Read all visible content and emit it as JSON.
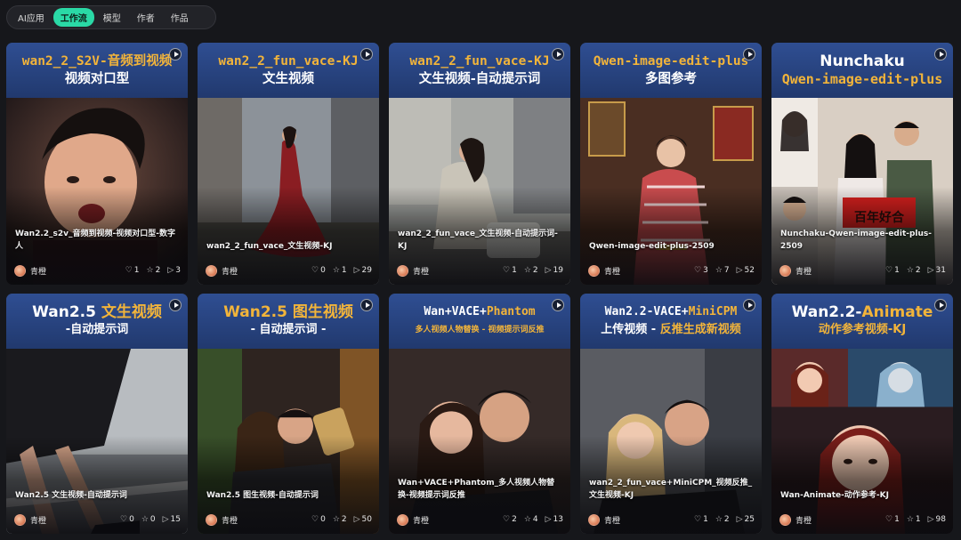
{
  "nav": {
    "tabs": [
      {
        "label": "AI应用"
      },
      {
        "label": "工作流"
      },
      {
        "label": "模型"
      },
      {
        "label": "作者"
      },
      {
        "label": "作品"
      }
    ],
    "active_index": 1
  },
  "icons": {
    "like": "heart-icon",
    "star": "star-icon",
    "play": "play-icon",
    "views": "play-triangle-icon"
  },
  "colors": {
    "accent": "#2ad9a6",
    "banner_blue": "#2f4e92",
    "banner_gold": "#f2b43a",
    "background": "#16171b"
  },
  "cards": [
    {
      "banner_line1": "wan2_2_S2V-音频到视频",
      "banner_line2": "视频对口型",
      "title": "Wan2.2_s2v_音频到视频-视频对口型-数字人",
      "author": "青橙",
      "likes": "1",
      "stars": "2",
      "views": "3"
    },
    {
      "banner_line1": "wan2_2_fun_vace-KJ",
      "banner_line2": "文生视频",
      "title": "wan2_2_fun_vace_文生视频-KJ",
      "author": "青橙",
      "likes": "0",
      "stars": "1",
      "views": "29"
    },
    {
      "banner_line1": "wan2_2_fun_vace-KJ",
      "banner_line2": "文生视频-自动提示词",
      "title": "wan2_2_fun_vace_文生视频-自动提示词-KJ",
      "author": "青橙",
      "likes": "1",
      "stars": "2",
      "views": "19"
    },
    {
      "banner_line1": "Qwen-image-edit-plus",
      "banner_line2": "多图参考",
      "title": "Qwen-image-edit-plus-2509",
      "author": "青橙",
      "likes": "3",
      "stars": "7",
      "views": "52"
    },
    {
      "banner_line1": "Nunchaku",
      "banner_line2": "Qwen-image-edit-plus",
      "title": "Nunchaku-Qwen-image-edit-plus-2509",
      "author": "青橙",
      "likes": "1",
      "stars": "2",
      "views": "31",
      "sign_text": "百年好合"
    },
    {
      "banner_line1_a": "Wan2.5 ",
      "banner_line1_b": "文生视频",
      "banner_line2": "-自动提示词",
      "title": "Wan2.5 文生视频-自动提示词",
      "author": "青橙",
      "likes": "0",
      "stars": "0",
      "views": "15"
    },
    {
      "banner_line1_a": "Wan2.5 ",
      "banner_line1_b": "图生视频",
      "banner_line2": "- 自动提示词 -",
      "title": "Wan2.5 图生视频-自动提示词",
      "author": "青橙",
      "likes": "0",
      "stars": "2",
      "views": "50"
    },
    {
      "banner_line1_a": "Wan+VACE+",
      "banner_line1_b": "Phantom",
      "banner_line2": "多人视频人物替换 - 视频提示词反推",
      "title": "Wan+VACE+Phantom_多人视频人物替换-视频提示词反推",
      "author": "青橙",
      "likes": "2",
      "stars": "4",
      "views": "13"
    },
    {
      "banner_line1_a": "Wan2.2-VACE+",
      "banner_line1_b": "MiniCPM",
      "banner_line2_a": "上传视频 - ",
      "banner_line2_b": "反推生成新视频",
      "title": "wan2_2_fun_vace+MiniCPM_视频反推_文生视频-KJ",
      "author": "青橙",
      "likes": "1",
      "stars": "2",
      "views": "25"
    },
    {
      "banner_line1_a": "Wan2.2-",
      "banner_line1_b": "Animate",
      "banner_line2": "动作参考视频-KJ",
      "title": "Wan-Animate-动作参考-KJ",
      "author": "青橙",
      "likes": "1",
      "stars": "1",
      "views": "98"
    }
  ]
}
